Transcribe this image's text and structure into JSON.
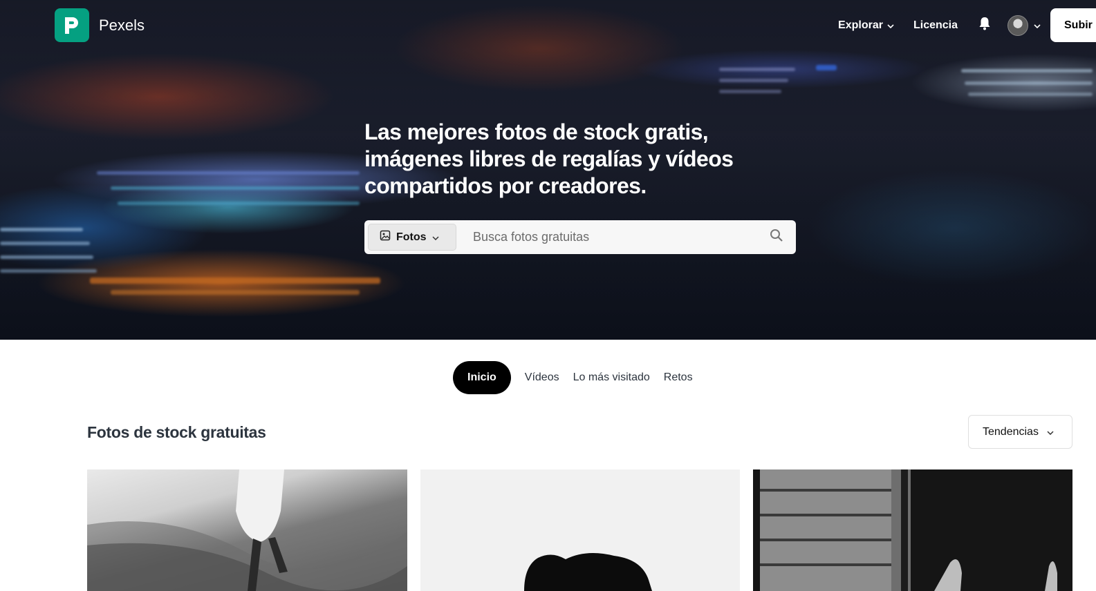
{
  "header": {
    "logo_text": "Pexels",
    "nav": {
      "explore_label": "Explorar",
      "license_label": "Licencia",
      "upload_label": "Subir"
    }
  },
  "hero": {
    "headline": "Las mejores fotos de stock gratis, imágenes libres de regalías y vídeos compartidos por creadores.",
    "search": {
      "type_label": "Fotos",
      "placeholder": "Busca fotos gratuitas"
    }
  },
  "tabs": [
    {
      "label": "Inicio",
      "active": true
    },
    {
      "label": "Vídeos",
      "active": false
    },
    {
      "label": "Lo más visitado",
      "active": false
    },
    {
      "label": "Retos",
      "active": false
    }
  ],
  "section": {
    "title": "Fotos de stock gratuitas",
    "sort_label": "Tendencias"
  },
  "icons": {
    "logo": "pexels-logo-icon",
    "explore_chevron": "chevron-down-icon",
    "notifications": "bell-icon",
    "search": "search-icon",
    "image_type": "image-icon"
  },
  "colors": {
    "brand": "#05a081",
    "active_tab": "#000000"
  }
}
